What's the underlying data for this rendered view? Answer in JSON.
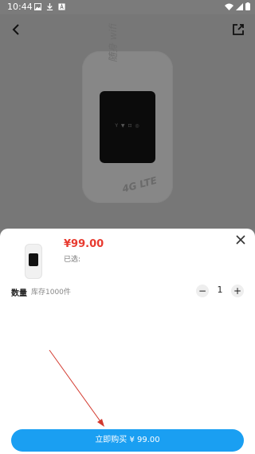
{
  "status_bar": {
    "time": "10:44",
    "left_icons": [
      "image-icon",
      "download-icon",
      "app-a-icon"
    ],
    "right_icons": [
      "wifi-icon",
      "signal-icon",
      "battery-icon"
    ]
  },
  "nav": {
    "back_icon": "chevron-left-icon",
    "share_icon": "share-icon"
  },
  "product_image": {
    "brand_text": "随身 wifi",
    "model_text": "4G LTE",
    "screen_icons": "Y ▼ ⊡ ◎"
  },
  "sheet": {
    "price": "¥99.00",
    "selected_label": "已选:",
    "quantity_label": "数量",
    "stock_text": "库存1000件",
    "quantity": "1",
    "minus_label": "−",
    "plus_label": "+",
    "close_icon": "close-icon",
    "buy_button": "立即购买 ¥ 99.00"
  },
  "colors": {
    "accent": "#1a9ff2",
    "price": "#e83a2f",
    "overlay": "#777777",
    "arrow": "#d33a2f"
  }
}
